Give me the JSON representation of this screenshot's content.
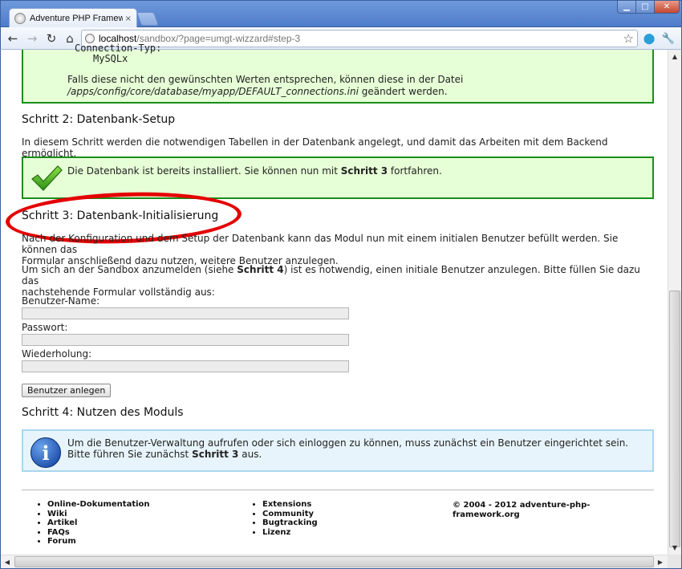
{
  "browser": {
    "tab_title": "Adventure PHP Framework sa",
    "tab_close": "×",
    "url_host": "localhost",
    "url_rest": "/sandbox/?page=umgt-wizzard#step-3",
    "controls": {
      "minimize": "▁",
      "maximize": "□",
      "close": "✕"
    }
  },
  "step1": {
    "mono1": "Connection-Typ:",
    "mono2": "MySQLx",
    "note_prefix": "Falls diese nicht den gewünschten Werten entsprechen, können diese in der Datei",
    "note_path": "/apps/config/core/database/myapp/DEFAULT_connections.ini",
    "note_suffix": " geändert werden."
  },
  "step2": {
    "heading": "Schritt 2: Datenbank-Setup",
    "text": "In diesem Schritt werden die notwendigen Tabellen in der Datenbank angelegt, und damit das Arbeiten mit dem Backend ermöglicht.",
    "success_prefix": "Die Datenbank ist bereits installiert. Sie können nun mit ",
    "success_bold": "Schritt 3",
    "success_suffix": " fortfahren."
  },
  "step3": {
    "heading": "Schritt 3: Datenbank-Initialisierung",
    "text1_line1": "Nach der Konfiguration und dem Setup der Datenbank kann das Modul nun mit einem initialen Benutzer befüllt werden. Sie können das",
    "text1_line2": "Formular anschließend dazu nutzen, weitere Benutzer anzulegen.",
    "text2_prefix": "Um sich an der Sandbox anzumelden (siehe ",
    "text2_bold": "Schritt 4",
    "text2_suffix": ") ist es notwendig, einen initiale Benutzer anzulegen. Bitte füllen Sie dazu das",
    "text2_line2": "nachstehende Formular vollständig aus:",
    "label_username": "Benutzer-Name:",
    "label_password": "Passwort:",
    "label_repeat": "Wiederholung:",
    "username_value": "",
    "password_value": "",
    "repeat_value": "",
    "submit_label": "Benutzer anlegen"
  },
  "step4": {
    "heading": "Schritt 4: Nutzen des Moduls",
    "info_prefix": "Um die Benutzer-Verwaltung aufrufen oder sich einloggen zu können, muss zunächst ein Benutzer eingerichtet sein. Bitte führen Sie zunächst ",
    "info_bold": "Schritt 3",
    "info_suffix": " aus."
  },
  "footer": {
    "col1": [
      "Online-Dokumentation",
      "Wiki",
      "Artikel",
      "FAQs",
      "Forum"
    ],
    "col2": [
      "Extensions",
      "Community",
      "Bugtracking",
      "Lizenz"
    ],
    "copyright": "© 2004 - 2012 adventure-php-framework.org"
  },
  "colors": {
    "success_border": "#1c8d1c",
    "success_bg": "#e6ffd6",
    "info_border": "#a9d7ee",
    "info_bg": "#e7f4fb",
    "highlight": "#e50000"
  }
}
